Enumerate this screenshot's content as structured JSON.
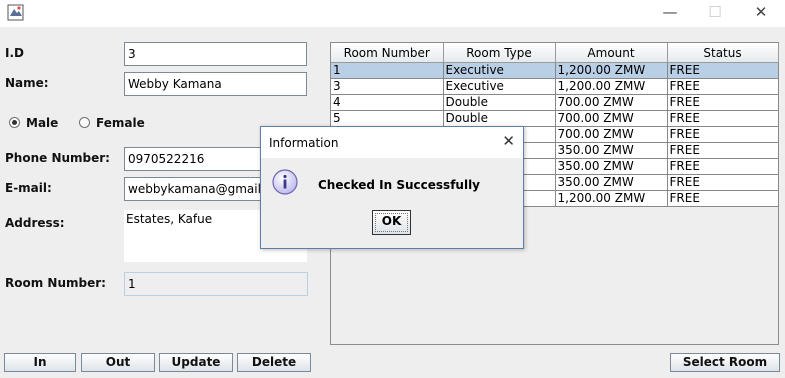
{
  "window": {
    "minimize": "—",
    "maximize": "☐",
    "close": "✕"
  },
  "form": {
    "id_label": "I.D",
    "id_value": "3",
    "name_label": "Name:",
    "name_value": "Webby Kamana",
    "gender": {
      "male_label": "Male",
      "female_label": "Female",
      "selected": "Male"
    },
    "phone_label": "Phone Number:",
    "phone_value": "0970522216",
    "email_label": "E-mail:",
    "email_value": "webbykamana@gmail.com",
    "address_label": "Address:",
    "address_value": "Estates, Kafue",
    "room_label": "Room Number:",
    "room_value": "1"
  },
  "buttons": {
    "in": "In",
    "out": "Out",
    "update": "Update",
    "delete": "Delete",
    "select_room": "Select Room"
  },
  "table": {
    "columns": [
      "Room Number",
      "Room Type",
      "Amount",
      "Status"
    ],
    "rows": [
      [
        "1",
        "Executive",
        "1,200.00 ZMW",
        "FREE"
      ],
      [
        "3",
        "Executive",
        "1,200.00 ZMW",
        "FREE"
      ],
      [
        "4",
        "Double",
        "700.00 ZMW",
        "FREE"
      ],
      [
        "5",
        "Double",
        "700.00 ZMW",
        "FREE"
      ],
      [
        "",
        "",
        "700.00 ZMW",
        "FREE"
      ],
      [
        "",
        "",
        "350.00 ZMW",
        "FREE"
      ],
      [
        "",
        "",
        "350.00 ZMW",
        "FREE"
      ],
      [
        "",
        "",
        "350.00 ZMW",
        "FREE"
      ],
      [
        "",
        "",
        "1,200.00 ZMW",
        "FREE"
      ]
    ],
    "selected_row": 0
  },
  "dialog": {
    "title": "Information",
    "close": "✕",
    "message": "Checked In Successfully",
    "ok": "OK",
    "icon": "info-icon"
  },
  "colors": {
    "selection": "#b8cfe5",
    "background": "#eeeeee"
  }
}
